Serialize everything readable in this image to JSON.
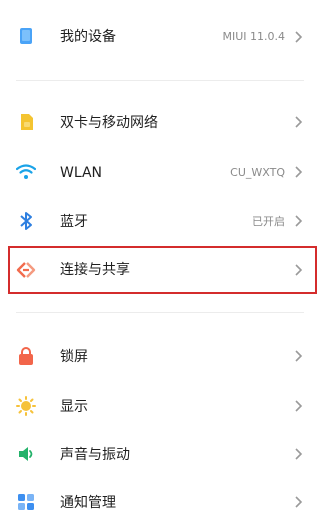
{
  "rows": [
    {
      "label": "我的设备",
      "value": "MIUI 11.0.4",
      "icon": "phone-icon"
    },
    {
      "label": "双卡与移动网络",
      "value": "",
      "icon": "sim-card-icon"
    },
    {
      "label": "WLAN",
      "value": "CU_WXTQ",
      "icon": "wifi-icon"
    },
    {
      "label": "蓝牙",
      "value": "已开启",
      "icon": "bluetooth-icon"
    },
    {
      "label": "连接与共享",
      "value": "",
      "icon": "connection-share-icon"
    },
    {
      "label": "锁屏",
      "value": "",
      "icon": "lock-icon"
    },
    {
      "label": "显示",
      "value": "",
      "icon": "sun-icon"
    },
    {
      "label": "声音与振动",
      "value": "",
      "icon": "speaker-icon"
    },
    {
      "label": "通知管理",
      "value": "",
      "icon": "notification-icon"
    }
  ],
  "colors": {
    "highlight": "#d42c2c",
    "phone": "#4aa3f7",
    "sim": "#f4c431",
    "wifi": "#1aa3e8",
    "bluetooth": "#2e7fe0",
    "connection": "#f26b4d",
    "lock": "#f2654a",
    "sun": "#f6c23a",
    "speaker": "#23b26a",
    "notification": "#3d8ff0"
  }
}
